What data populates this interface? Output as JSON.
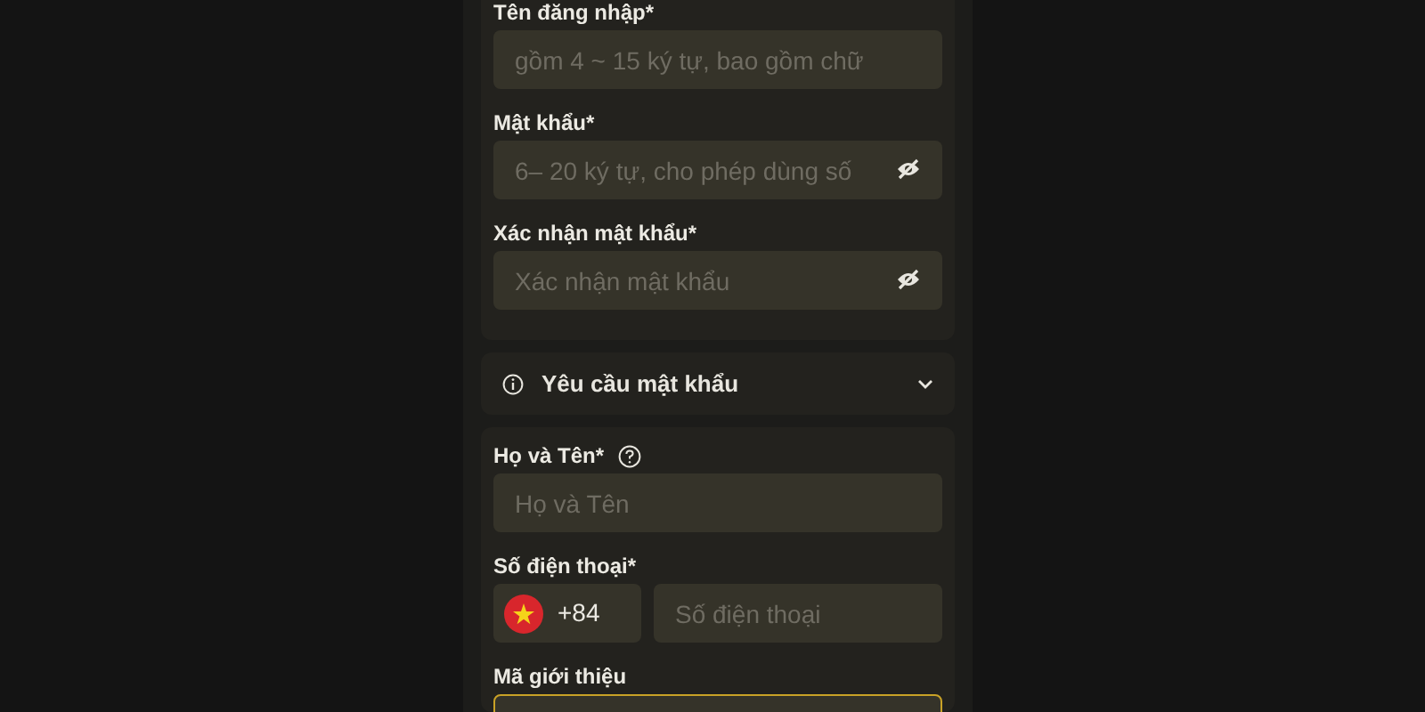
{
  "account_card": {
    "fields": [
      {
        "label": "Tên đăng nhập*",
        "placeholder": "gồm 4 ~ 15 ký tự, bao gồm chữ",
        "kind": "text"
      },
      {
        "label": "Mật khẩu*",
        "placeholder": "6– 20 ký tự, cho phép dùng số",
        "kind": "password"
      },
      {
        "label": "Xác nhận mật khẩu*",
        "placeholder": "Xác nhận mật khẩu",
        "kind": "password"
      }
    ]
  },
  "password_requirements": {
    "label": "Yêu cầu mật khẩu",
    "expanded": false
  },
  "profile_card": {
    "full_name": {
      "label": "Họ và Tên*",
      "placeholder": "Họ và Tên"
    },
    "phone": {
      "label": "Số điện thoại*",
      "country_code": "+84",
      "placeholder": "Số điện thoại"
    },
    "referral": {
      "label": "Mã giới thiệu",
      "focused": true
    }
  }
}
